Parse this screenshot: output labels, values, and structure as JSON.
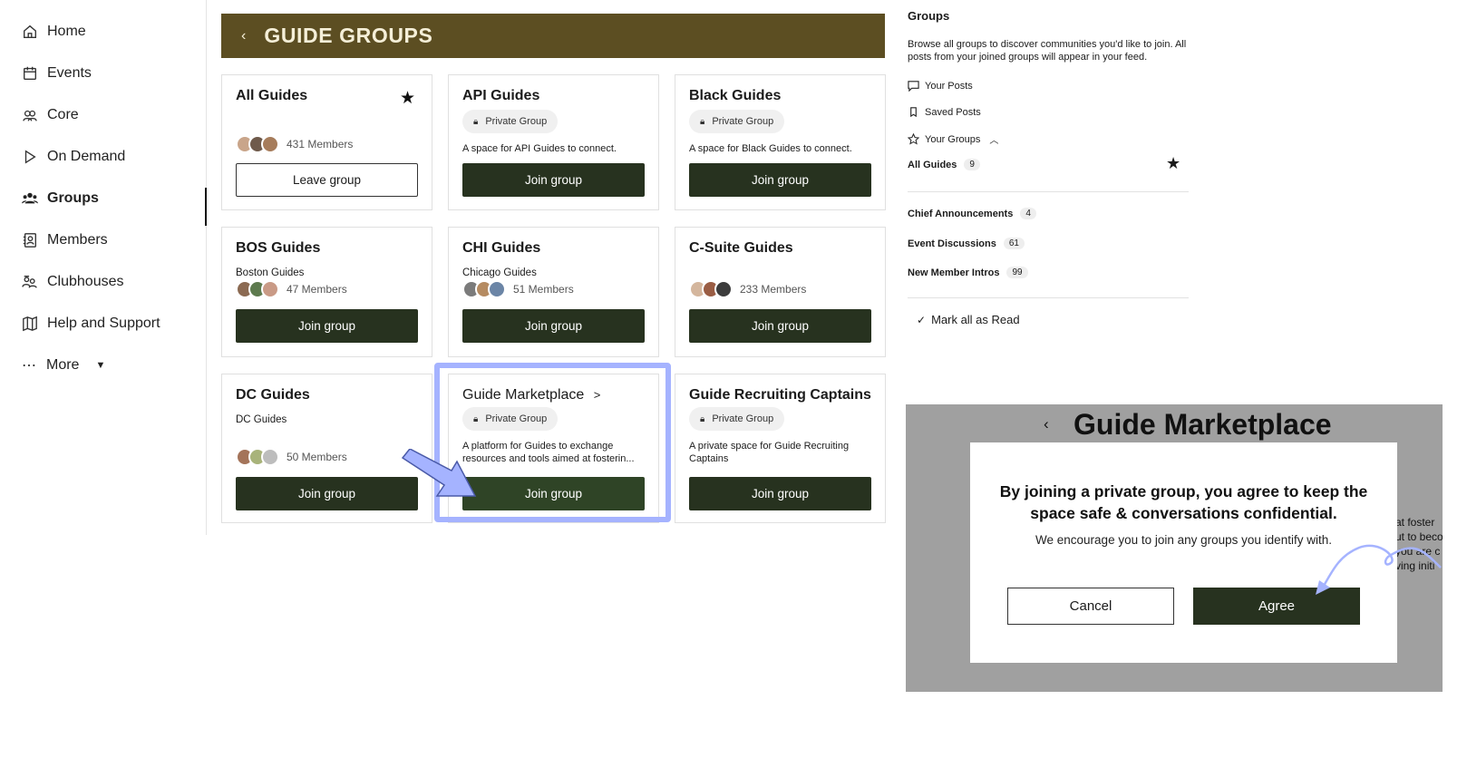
{
  "nav": {
    "items": [
      {
        "label": "Home",
        "icon": "home-icon"
      },
      {
        "label": "Events",
        "icon": "calendar-icon"
      },
      {
        "label": "Core",
        "icon": "core-icon"
      },
      {
        "label": "On Demand",
        "icon": "play-icon"
      },
      {
        "label": "Groups",
        "icon": "groups-icon",
        "active": true
      },
      {
        "label": "Members",
        "icon": "members-icon"
      },
      {
        "label": "Clubhouses",
        "icon": "clubhouses-icon"
      },
      {
        "label": "Help and Support",
        "icon": "map-icon"
      },
      {
        "label": "More",
        "icon": "more-icon"
      }
    ]
  },
  "banner": {
    "title": "GUIDE GROUPS"
  },
  "cards": [
    {
      "title": "All Guides",
      "members": "431 Members",
      "button": "Leave group"
    },
    {
      "title": "API Guides",
      "pill": "Private Group",
      "desc": "A space for API Guides to connect.",
      "button": "Join group"
    },
    {
      "title": "Black Guides",
      "pill": "Private Group",
      "desc": "A space for Black Guides to connect.",
      "button": "Join group"
    },
    {
      "title": "BOS Guides",
      "sub": "Boston Guides",
      "members": "47 Members",
      "button": "Join group"
    },
    {
      "title": "CHI Guides",
      "sub": "Chicago Guides",
      "members": "51 Members",
      "button": "Join group"
    },
    {
      "title": "C-Suite Guides",
      "members": "233 Members",
      "button": "Join group"
    },
    {
      "title": "DC Guides",
      "sub": "DC Guides",
      "members": "50 Members",
      "button": "Join group"
    },
    {
      "title": "Guide Marketplace",
      "title_suffix": ">",
      "pill": "Private Group",
      "desc": "A platform for Guides to exchange resources and tools aimed at fosterin...",
      "button": "Join group"
    },
    {
      "title": "Guide Recruiting Captains",
      "pill": "Private Group",
      "desc": "A private space for Guide Recruiting Captains",
      "button": "Join group"
    }
  ],
  "right_panel": {
    "heading": "Groups",
    "desc": "Browse all groups to discover communities you'd like to join. All posts from your joined groups will appear in your feed.",
    "links": [
      "Your Posts",
      "Saved Posts",
      "Your Groups"
    ],
    "groups": [
      {
        "name": "All Guides",
        "count": "9"
      },
      {
        "name": "Chief Announcements",
        "count": "4"
      },
      {
        "name": "Event Discussions",
        "count": "61"
      },
      {
        "name": "New Member Intros",
        "count": "99"
      }
    ],
    "mark_read": "Mark all as Read"
  },
  "modal": {
    "bg_title": "Guide Marketplace",
    "bg_text": [
      "at foster",
      "ut to beco",
      "you are c",
      "ving initi"
    ],
    "title": "By joining a private group, you agree to keep the space safe & conversations confidential.",
    "text": "We encourage you to join any groups you identify with.",
    "cancel": "Cancel",
    "agree": "Agree"
  },
  "colors": {
    "banner": "#5c4e22",
    "button": "#27321f",
    "highlight": "#a5b3ff",
    "overlay": "#a0a0a0"
  }
}
